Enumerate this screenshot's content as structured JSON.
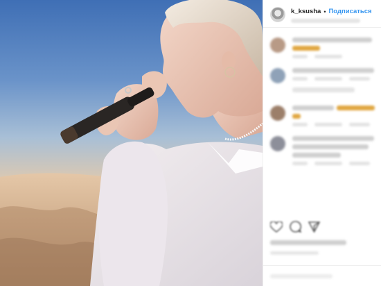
{
  "post": {
    "username": "k_ksusha",
    "separator": "•",
    "follow_label": "Подписаться"
  },
  "colors": {
    "follow": "#3897f0",
    "username": "#262626"
  },
  "icons": {
    "like": "heart-icon",
    "comment": "comment-icon",
    "share": "share-icon"
  }
}
